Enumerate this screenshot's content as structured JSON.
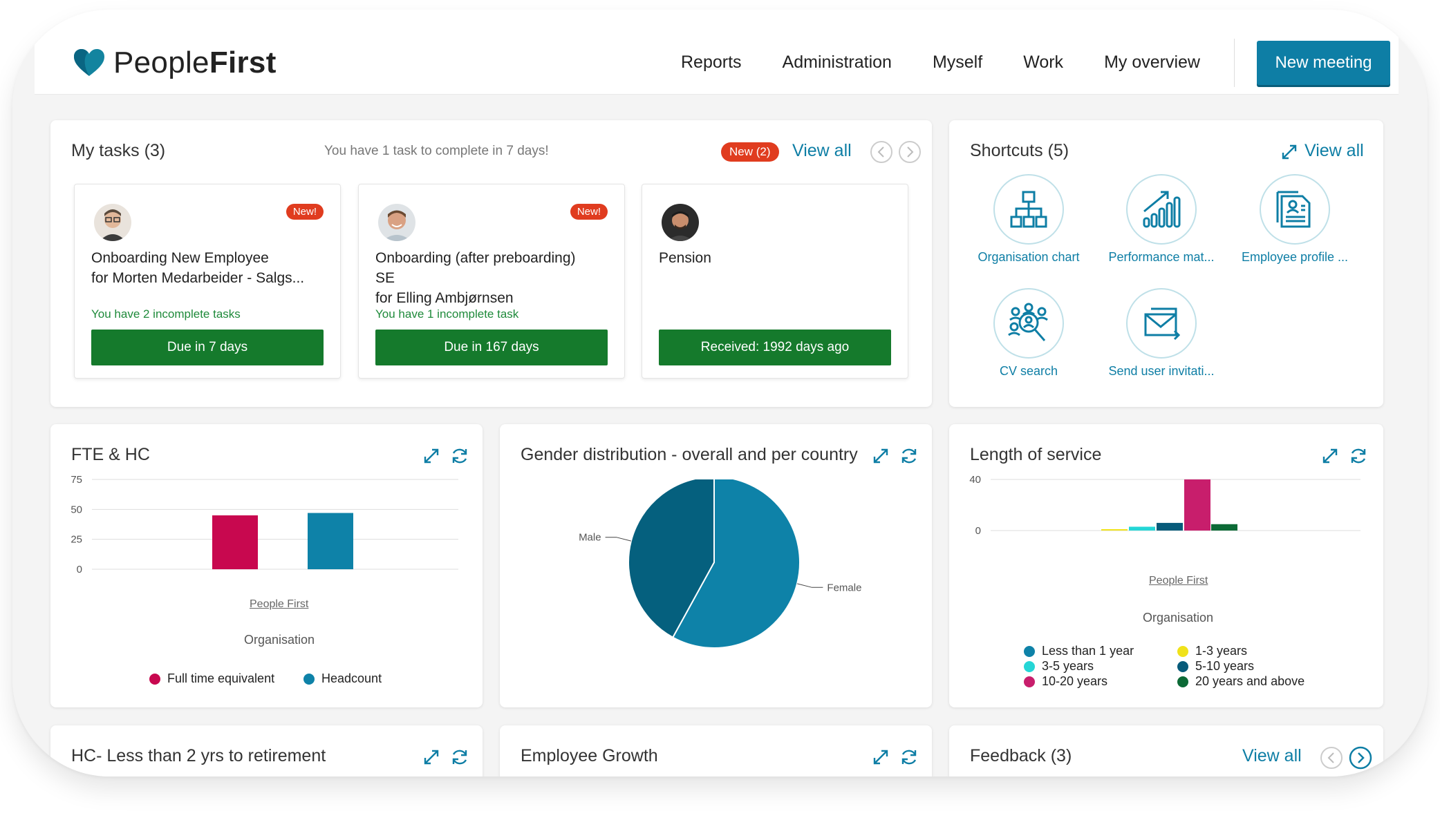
{
  "app": {
    "logo_text_light": "People",
    "logo_text_bold": "First",
    "brand_color": "#0e7ea5"
  },
  "nav": {
    "items": [
      "Reports",
      "Administration",
      "Myself",
      "Work",
      "My overview"
    ],
    "new_meeting": "New meeting"
  },
  "tasks": {
    "title": "My tasks (3)",
    "notice": "You have 1 task to complete in 7 days!",
    "new_badge": "New (2)",
    "view_all": "View all",
    "cards": [
      {
        "badge": "New!",
        "title_lines": [
          "Onboarding New Employee",
          "for Morten Medarbeider - Salgs..."
        ],
        "subtitle": "You have 2 incomplete tasks",
        "button": "Due in 7 days"
      },
      {
        "badge": "New!",
        "title_lines": [
          "Onboarding (after preboarding)",
          "SE",
          "for Elling Ambjørnsen"
        ],
        "subtitle": "You have 1 incomplete task",
        "button": "Due in 167 days"
      },
      {
        "badge": "",
        "title_lines": [
          "Pension"
        ],
        "subtitle": "",
        "button": "Received: 1992 days ago"
      }
    ]
  },
  "shortcuts": {
    "title": "Shortcuts (5)",
    "view_all": "View all",
    "items": [
      {
        "label": "Organisation chart",
        "icon": "org-chart-icon"
      },
      {
        "label": "Performance mat...",
        "icon": "bar-chart-growth-icon"
      },
      {
        "label": "Employee profile ...",
        "icon": "profile-document-icon"
      },
      {
        "label": "CV search",
        "icon": "people-search-icon"
      },
      {
        "label": "Send user invitati...",
        "icon": "envelope-icon"
      }
    ]
  },
  "widgets": {
    "fte": {
      "title": "FTE & HC",
      "category": "People First",
      "axis_title": "Organisation"
    },
    "gender": {
      "title": "Gender distribution - overall and per country"
    },
    "service": {
      "title": "Length of service",
      "category": "People First",
      "axis_title": "Organisation"
    },
    "retirement": {
      "title": "HC- Less than 2 yrs to retirement"
    },
    "growth": {
      "title": "Employee Growth"
    },
    "feedback": {
      "title": "Feedback (3)",
      "view_all": "View all"
    }
  },
  "chart_data": [
    {
      "type": "bar",
      "title": "FTE & HC",
      "xlabel": "Organisation",
      "categories": [
        "People First"
      ],
      "ylim": [
        0,
        75
      ],
      "yticks": [
        0,
        25,
        50,
        75
      ],
      "legend_position": "bottom",
      "series": [
        {
          "name": "Full time equivalent",
          "values": [
            45
          ],
          "color": "#c8084f"
        },
        {
          "name": "Headcount",
          "values": [
            47
          ],
          "color": "#0e82a8"
        }
      ]
    },
    {
      "type": "pie",
      "title": "Gender distribution - overall and per country",
      "labels": [
        "Female",
        "Male"
      ],
      "values": [
        58,
        42
      ],
      "colors": [
        "#0e82a8",
        "#05607e"
      ]
    },
    {
      "type": "bar",
      "title": "Length of service",
      "xlabel": "Organisation",
      "categories": [
        "People First"
      ],
      "ylim": [
        0,
        40
      ],
      "yticks": [
        0,
        40
      ],
      "legend_position": "bottom",
      "series": [
        {
          "name": "Less than 1 year",
          "values": [
            0
          ],
          "color": "#0e82a8"
        },
        {
          "name": "1-3 years",
          "values": [
            1
          ],
          "color": "#f0e21a"
        },
        {
          "name": "3-5 years",
          "values": [
            3
          ],
          "color": "#25d6d6"
        },
        {
          "name": "5-10 years",
          "values": [
            6
          ],
          "color": "#075b7a"
        },
        {
          "name": "10-20 years",
          "values": [
            40
          ],
          "color": "#c81e6c"
        },
        {
          "name": "20 years and above",
          "values": [
            5
          ],
          "color": "#0c6a36"
        }
      ]
    }
  ]
}
